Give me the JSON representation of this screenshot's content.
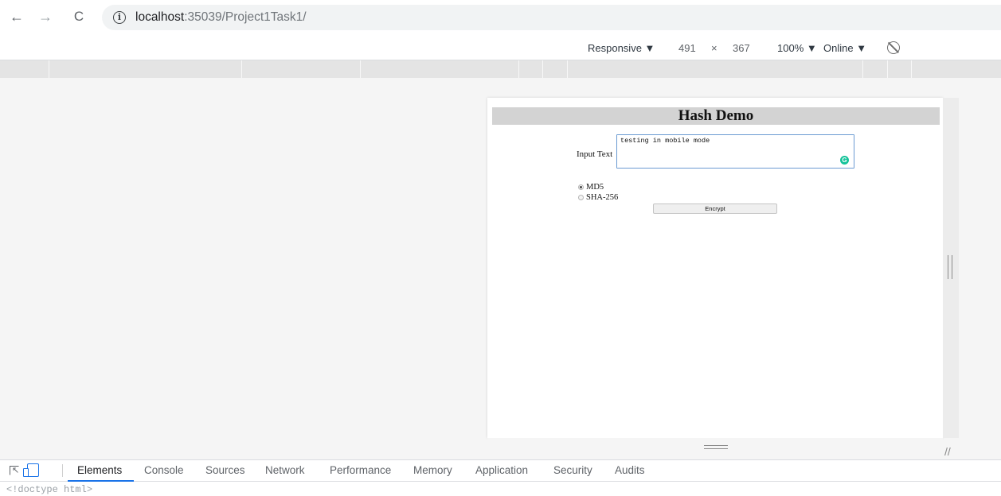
{
  "browser": {
    "url_host": "localhost",
    "url_path": ":35039/Project1Task1/",
    "back_glyph": "←",
    "forward_glyph": "→",
    "reload_glyph": "C"
  },
  "device_toolbar": {
    "mode": "Responsive ▼",
    "width": "491",
    "times": "×",
    "height": "367",
    "zoom": "100% ▼",
    "network": "Online ▼"
  },
  "page": {
    "title": "Hash Demo",
    "input_label": "Input Text",
    "input_value": "testing in mobile mode",
    "radio_md5": "MD5",
    "radio_sha": "SHA-256",
    "encrypt_label": "Encrypt",
    "grammarly_glyph": "G"
  },
  "devtools": {
    "tabs": [
      "Elements",
      "Console",
      "Sources",
      "Network",
      "Performance",
      "Memory",
      "Application",
      "Security",
      "Audits"
    ],
    "doctype": "<!doctype html>"
  },
  "colors": {
    "accent": "#1a73e8",
    "grammarly": "#15c39a"
  }
}
